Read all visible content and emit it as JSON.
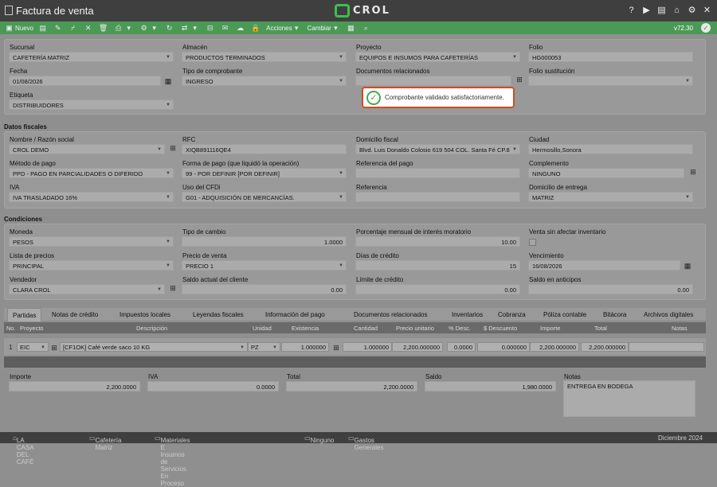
{
  "window": {
    "title": "Factura de venta",
    "logo_text": "CROL"
  },
  "toolbar": {
    "nuevo": "Nuevo",
    "acciones": "Acciones",
    "cambiar": "Cambiar",
    "version": "v72.30"
  },
  "general": {
    "sucursal_label": "Sucursal",
    "sucursal": "CAFETERÍA MATRIZ",
    "almacen_label": "Almacén",
    "almacen": "PRODUCTOS TERMINADOS",
    "proyecto_label": "Proyecto",
    "proyecto": "EQUIPOS E INSUMOS PARA CAFETERÍAS",
    "folio_label": "Folio",
    "folio": "HG000053",
    "fecha_label": "Fecha",
    "fecha": "01/08/2026",
    "tipo_comprobante_label": "Tipo de comprobante",
    "tipo_comprobante": "INGRESO",
    "documentos_label": "Documentos relacionados",
    "documentos": "",
    "folio_sust_label": "Folio sustitución",
    "folio_sust": "",
    "etiqueta_label": "Etiqueta",
    "etiqueta": "DISTRIBUIDORES"
  },
  "toast": {
    "message": "Comprobante validado satisfactoriamente."
  },
  "fiscales": {
    "section": "Datos fiscales",
    "nombre_label": "Nombre / Razón social",
    "nombre": "CROL DEMO",
    "rfc_label": "RFC",
    "rfc": "XIQB891116QE4",
    "domicilio_label": "Domicilio fiscal",
    "domicilio": "Blvd. Luis Donaldo Colosio 619 504 COL. Santa Fé CP.8",
    "ciudad_label": "Ciudad",
    "ciudad": "Hermosillo,Sonora",
    "metodo_label": "Método de pago",
    "metodo": "PPD - PAGO EN PARCIALIDADES O DIFERIDO",
    "forma_label": "Forma de pago (que liquidó la operación)",
    "forma": "99 - POR DEFINIR [POR DEFINIR]",
    "ref_pago_label": "Referencia del pago",
    "ref_pago": "",
    "complemento_label": "Complemento",
    "complemento": "NINGUNO",
    "iva_label": "IVA",
    "iva": "IVA TRASLADADO 16%",
    "uso_label": "Uso del CFDi",
    "uso": "G01 - ADQUISICIÓN DE MERCANCÍAS.",
    "referencia_label": "Referencia",
    "referencia": "",
    "dom_entrega_label": "Domicilio de entrega",
    "dom_entrega": "MATRIZ"
  },
  "condiciones": {
    "section": "Condiciones",
    "moneda_label": "Moneda",
    "moneda": "PESOS",
    "tipo_cambio_label": "Tipo de cambio",
    "tipo_cambio": "1.0000",
    "interes_label": "Porcentaje mensual de interés moratorio",
    "interes": "10.00",
    "venta_sin_label": "Venta sin afectar inventario",
    "lista_label": "Lista de precios",
    "lista": "PRINCIPAL",
    "precio_label": "Precio de venta",
    "precio": "PRECIO 1",
    "dias_label": "Días de crédito",
    "dias": "15",
    "vencimiento_label": "Vencimiento",
    "vencimiento": "16/08/2026",
    "vendedor_label": "Vendedor",
    "vendedor": "CLARA CROL",
    "saldo_cliente_label": "Saldo actual del cliente",
    "saldo_cliente": "0.00",
    "limite_label": "Límite de crédito",
    "limite": "0.00",
    "anticipos_label": "Saldo en anticipos",
    "anticipos": "0.00"
  },
  "tabs": [
    "Partidas",
    "Notas de crédito",
    "Impuestos locales",
    "Leyendas fiscales",
    "Información del pago",
    "Documentos relacionados",
    "Inventarios",
    "Cobranza",
    "Póliza contable",
    "Bitácora",
    "Archivos digitales"
  ],
  "grid": {
    "headers": {
      "no": "No.",
      "proyecto": "Proyecto",
      "descripcion": "Descripción",
      "unidad": "Unidad",
      "existencia": "Existencia",
      "cantidad": "Cantidad",
      "precio": "Precio unitario",
      "pdesc": "% Desc.",
      "sdesc": "$ Descuento",
      "importe": "Importe",
      "total": "Total",
      "notas": "Notas"
    },
    "row": {
      "no": "1",
      "proyecto": "EIC",
      "descripcion": "[CF1OK] Café verde saco 10 KG",
      "unidad": "PZ",
      "existencia": "1.000000",
      "cantidad": "1.000000",
      "precio": "2,200.000000",
      "pdesc": "0.0000",
      "sdesc": "0.000000",
      "importe": "2,200.000000",
      "total": "2,200.000000",
      "notas": ""
    }
  },
  "totals": {
    "importe_label": "Importe",
    "importe": "2,200.0000",
    "iva_label": "IVA",
    "iva": "0.0000",
    "total_label": "Total",
    "total": "2,200.0000",
    "saldo_label": "Saldo",
    "saldo": "1,980.0000",
    "notas_label": "Notas",
    "notas": "ENTREGA EN BODEGA"
  },
  "status": {
    "empresa": "LA CASA DEL CAFÉ",
    "sucursal": "Cafetería Matriz",
    "proyecto": "Materiales E Insumos de Servicios En Proceso",
    "almacen": "Ninguno",
    "gastos": "Gastos Generales",
    "periodo": "Diciembre 2024"
  }
}
